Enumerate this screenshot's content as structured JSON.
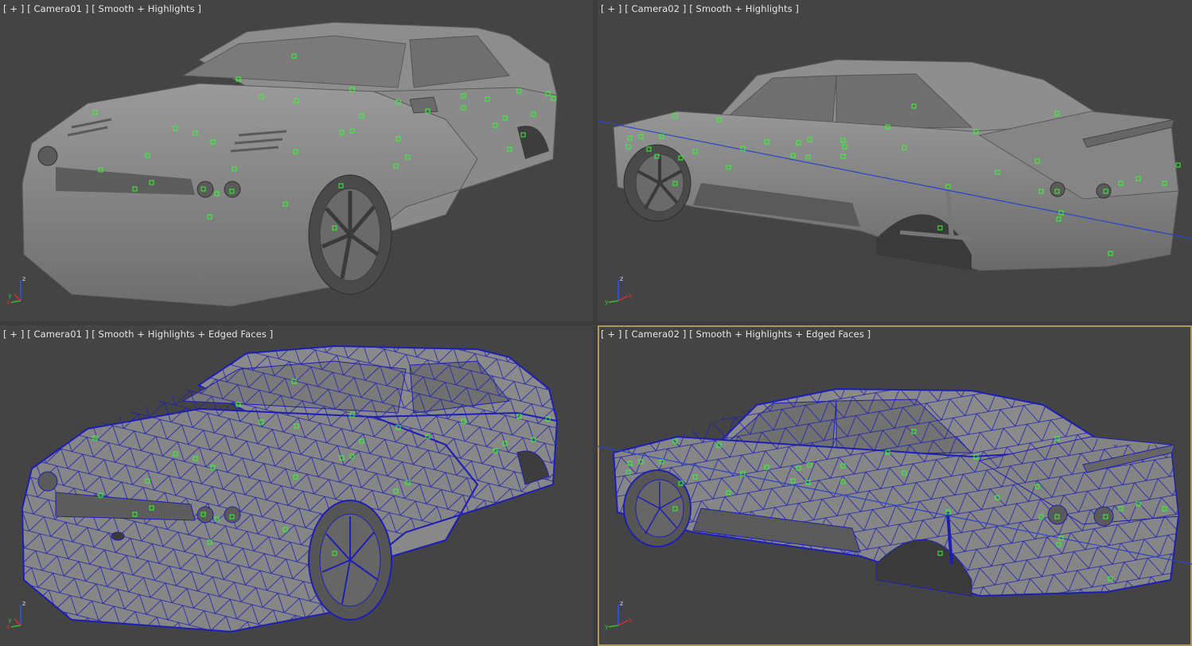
{
  "viewports": [
    {
      "id": "tl",
      "menu": "[ + ]",
      "camera": "[ Camera01 ]",
      "mode": "[ Smooth + Highlights ]",
      "active": false
    },
    {
      "id": "tr",
      "menu": "[ + ]",
      "camera": "[ Camera02 ]",
      "mode": "[ Smooth + Highlights ]",
      "active": false
    },
    {
      "id": "bl",
      "menu": "[ + ]",
      "camera": "[ Camera01 ]",
      "mode": "[ Smooth + Highlights + Edged Faces ]",
      "active": false
    },
    {
      "id": "br",
      "menu": "[ + ]",
      "camera": "[ Camera02 ]",
      "mode": "[ Smooth + Highlights + Edged Faces ]",
      "active": true
    }
  ],
  "axis_gizmo": {
    "x": "x",
    "y": "y",
    "z": "z"
  },
  "colors": {
    "viewport_bg": "#444444",
    "border": "#2b2b2b",
    "active_border": "#b1955a",
    "wire": "#1e1eb4",
    "helper": "#2dff2d",
    "model": "#8a8a8a",
    "gizmo_x": "#d83030",
    "gizmo_y": "#30c030",
    "gizmo_z": "#3050ff"
  }
}
